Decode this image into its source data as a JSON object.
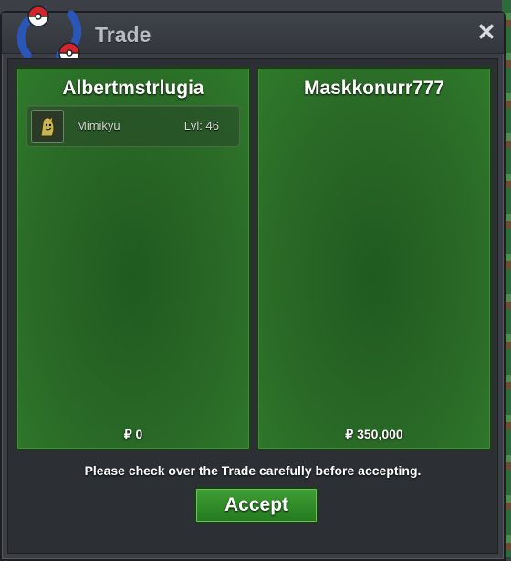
{
  "window": {
    "title": "Trade",
    "close_label": "✕"
  },
  "left_panel": {
    "player": "Albertmstrlugia",
    "items": [
      {
        "name": "Mimikyu",
        "level": "Lvl: 46",
        "icon": "mimikyu-icon"
      }
    ],
    "money": "₽ 0"
  },
  "right_panel": {
    "player": "Maskkonurr777",
    "items": [],
    "money": "₽ 350,000"
  },
  "footer": {
    "message": "Please check over the Trade carefully before accepting.",
    "accept_label": "Accept"
  },
  "colors": {
    "panel_green": "#2a6a27",
    "accent_green": "#3f9f34",
    "window_bg": "#3b3e44"
  }
}
